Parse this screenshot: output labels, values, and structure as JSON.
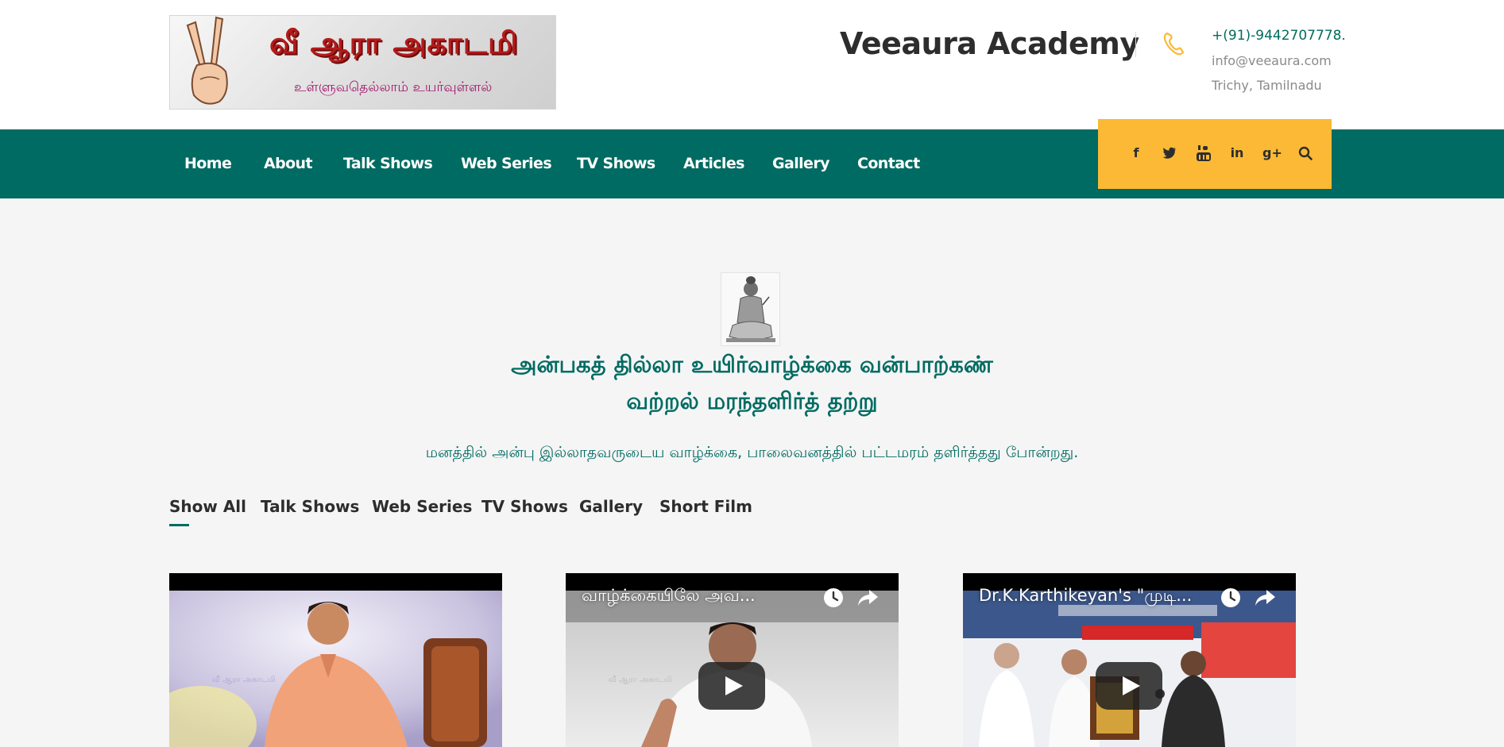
{
  "header": {
    "logo_text_main": "வீ ஆரா அகாடமி",
    "logo_text_sub": "உள்ளுவதெல்லாம் உயர்வுள்ளல்",
    "site_title": "Veeaura Academy",
    "phone": "+(91)-9442707778.",
    "email": "info@veeaura.com",
    "location": "Trichy, Tamilnadu"
  },
  "nav": {
    "items": [
      "Home",
      "About",
      "Talk Shows",
      "Web Series",
      "TV Shows",
      "Articles",
      "Gallery",
      "Contact"
    ]
  },
  "social": {
    "icons": [
      "facebook-icon",
      "twitter-icon",
      "youtube-icon",
      "linkedin-icon",
      "google-plus-icon",
      "search-icon"
    ],
    "facebook": "f",
    "linkedin": "in",
    "google_plus": "g+"
  },
  "quote": {
    "line1": "அன்பகத் தில்லா உயிர்வாழ்க்கை வன்பாற்கண்",
    "line2": "வற்றல் மரந்தளிர்த் தற்று",
    "meaning": "மனத்தில் அன்பு இல்லாதவருடைய வாழ்க்கை, பாலைவனத்தில் பட்டமரம் தளிர்த்தது போன்றது."
  },
  "filters": {
    "tabs": [
      "Show All",
      "Talk Shows",
      "Web Series",
      "TV Shows",
      "Gallery",
      "Short Film"
    ],
    "active": "Show All"
  },
  "videos": [
    {
      "title": ""
    },
    {
      "title": "வாழ்க்கையிலே அவ..."
    },
    {
      "title": "Dr.K.Karthikeyan's \"முடி..."
    }
  ],
  "colors": {
    "brand_teal": "#006b62",
    "accent_yellow": "#fbb935",
    "text_dark": "#2d2d2d",
    "text_muted": "#8a8a8a"
  }
}
